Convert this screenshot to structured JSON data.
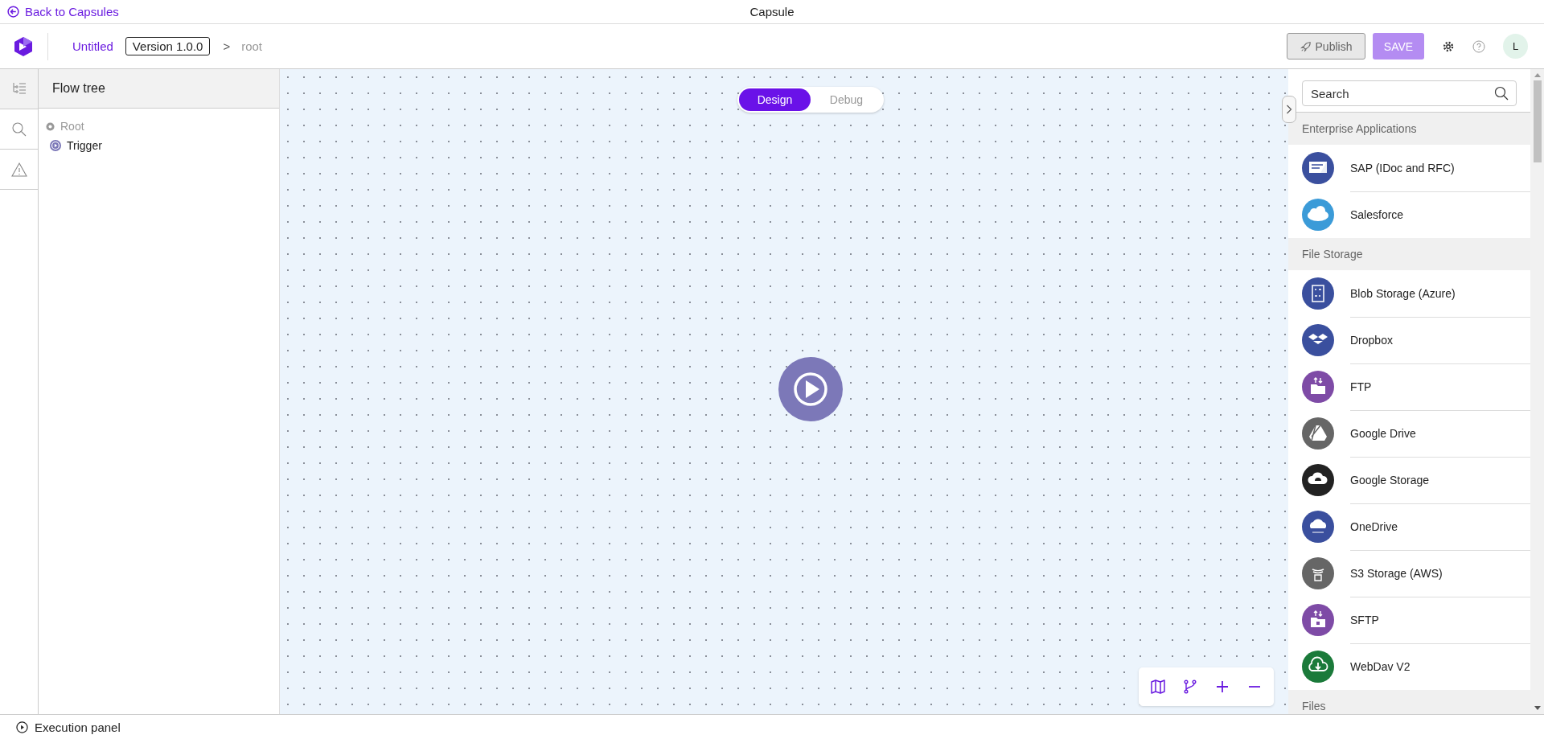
{
  "title_bar": {
    "back_link": "Back to Capsules",
    "title": "Capsule"
  },
  "header": {
    "name": "Untitled",
    "version": "Version 1.0.0",
    "separator": ">",
    "path": "root",
    "publish": "Publish",
    "save": "SAVE",
    "avatar": "L"
  },
  "rail": [
    {
      "selected": true
    },
    {
      "selected": false
    },
    {
      "selected": false
    }
  ],
  "flow_tree": {
    "title": "Flow tree",
    "items": [
      {
        "label": "Root",
        "disabled": true,
        "children": [
          {
            "label": "Trigger",
            "disabled": false
          }
        ]
      }
    ]
  },
  "mode_tabs": [
    {
      "label": "Design",
      "selected": true
    },
    {
      "label": "Debug",
      "selected": false
    }
  ],
  "connectors": {
    "search": {
      "placeholder": "Search"
    },
    "entries": [
      {
        "kind": "header",
        "label": "Enterprise Applications"
      },
      {
        "kind": "item",
        "label": "SAP (IDoc and RFC)",
        "color": "#3a4f9e"
      },
      {
        "kind": "item",
        "label": "Salesforce",
        "color": "#3b9bd8"
      },
      {
        "kind": "header",
        "label": "File Storage"
      },
      {
        "kind": "item",
        "label": "Blob Storage (Azure)",
        "color": "#3a4f9e"
      },
      {
        "kind": "item",
        "label": "Dropbox",
        "color": "#3a4f9e"
      },
      {
        "kind": "item",
        "label": "FTP",
        "color": "#7e4ba6"
      },
      {
        "kind": "item",
        "label": "Google Drive",
        "color": "#666666"
      },
      {
        "kind": "item",
        "label": "Google Storage",
        "color": "#222222"
      },
      {
        "kind": "item",
        "label": "OneDrive",
        "color": "#3a4f9e"
      },
      {
        "kind": "item",
        "label": "S3 Storage (AWS)",
        "color": "#666666"
      },
      {
        "kind": "item",
        "label": "SFTP",
        "color": "#7e4ba6"
      },
      {
        "kind": "item",
        "label": "WebDav V2",
        "color": "#1b7a3a"
      },
      {
        "kind": "header",
        "label": "Files"
      }
    ]
  },
  "footer": {
    "label": "Execution panel"
  }
}
